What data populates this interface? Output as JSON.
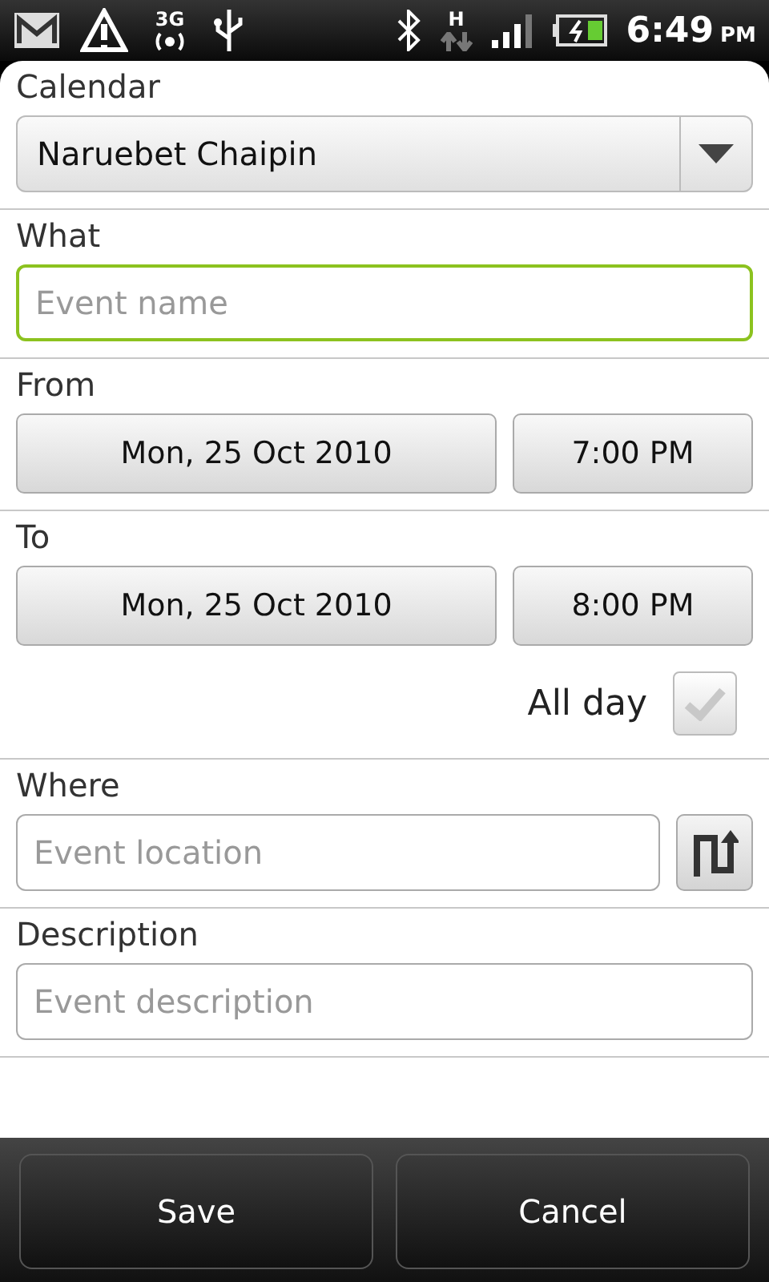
{
  "status_bar": {
    "network": "3G",
    "data": "H",
    "time": "6:49",
    "ampm": "PM"
  },
  "calendar": {
    "label": "Calendar",
    "value": "Naruebet Chaipin"
  },
  "what": {
    "label": "What",
    "placeholder": "Event name",
    "focused": true
  },
  "from": {
    "label": "From",
    "date": "Mon, 25 Oct 2010",
    "time": "7:00 PM"
  },
  "to": {
    "label": "To",
    "date": "Mon, 25 Oct 2010",
    "time": "8:00 PM"
  },
  "all_day": {
    "label": "All day",
    "checked": false
  },
  "where": {
    "label": "Where",
    "placeholder": "Event location",
    "focused": false
  },
  "description": {
    "label": "Description",
    "placeholder": "Event description",
    "focused": false
  },
  "buttons": [
    "Save",
    "Cancel"
  ]
}
